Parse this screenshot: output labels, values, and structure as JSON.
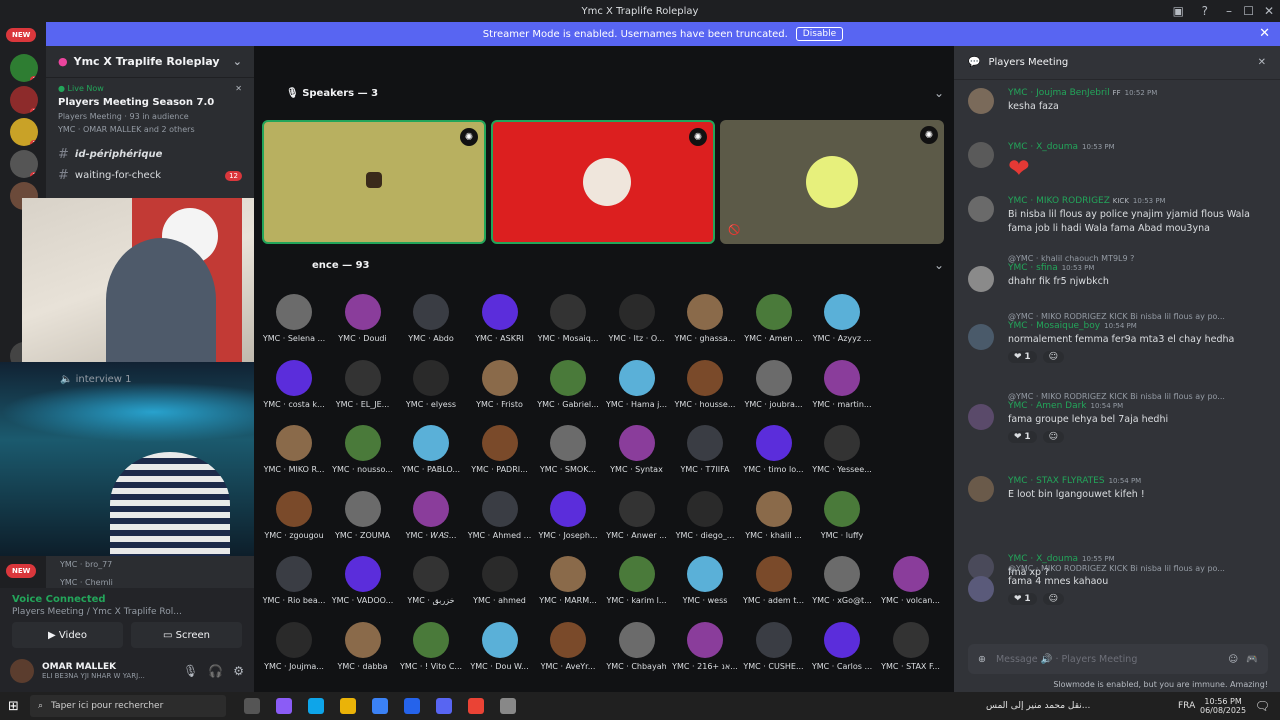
{
  "window": {
    "title": "Ymc X Traplife Roleplay"
  },
  "banner": {
    "text": "Streamer Mode is enabled. Usernames have been truncated.",
    "button": "Disable"
  },
  "servers": {
    "new_top": "NEW",
    "new_bottom": "NEW",
    "badges": [
      "1",
      "1",
      "2",
      "1",
      "1"
    ]
  },
  "guild": {
    "name": "Ymc X Traplife Roleplay"
  },
  "event": {
    "live": "Live Now",
    "title": "Players Meeting Season 7.0",
    "meta1": "Players Meeting · 93 in audience",
    "meta2": "YMC · OMAR MALLEK and 2 others"
  },
  "channels": [
    {
      "name": "id-périphérique",
      "count": ""
    },
    {
      "name": "waiting-for-check",
      "count": "12"
    },
    {
      "name": "interview 1",
      "count": ""
    }
  ],
  "voice": {
    "status": "Voice Connected",
    "sub": "Players Meeting / Ymc X Traplife Rol...",
    "video": "Video",
    "screen": "Screen",
    "members": [
      "YMC · bro_77",
      "YMC · Chemli"
    ]
  },
  "user": {
    "name": "OMAR MALLEK",
    "status": "ELI BE3NA YJI NHAR W YARJ..."
  },
  "stage": {
    "speakers_title": "Speakers — 3",
    "audience_title": "ence — 93"
  },
  "audience": [
    [
      "YMC · Selena ...",
      "YMC · Doudi",
      "YMC · Abdo",
      "YMC · ASKRI",
      "YMC · Mosaiq...",
      "YMC · Itz · O...",
      "YMC · ghassa...",
      "YMC · Amen ...",
      "YMC · Azyyz ..."
    ],
    [
      "YMC · costa k...",
      "YMC · EL_JE...",
      "YMC · elyess",
      "YMC · Fristo",
      "YMC · Gabriel...",
      "YMC · Hama j...",
      "YMC · housse...",
      "YMC · joubra...",
      "YMC · martin..."
    ],
    [
      "YMC · MIKO R...",
      "YMC · nousso...",
      "YMC · PABLO...",
      "YMC · PADRI...",
      "YMC · SMOK...",
      "YMC · Syntax",
      "YMC · T7IIFA",
      "YMC · timo lo...",
      "YMC · Yessee..."
    ],
    [
      "YMC · zgougou",
      "YMC · ZOUMA",
      "YMC · 𝑊𝐴𝑆...",
      "YMC · Ahmed ...",
      "YMC · Joseph...",
      "YMC · Anwer ...",
      "YMC · diego_...",
      "YMC · khalil ...",
      "YMC · luffy"
    ],
    [
      "YMC · Rio bea...",
      "YMC · VADOO...",
      "YMC · خزربق",
      "YMC · ahmed",
      "YMC · MARM...",
      "YMC · karim l...",
      "YMC · wess",
      "YMC · adem t...",
      "YMC · xGo@t...",
      "YMC · volcan..."
    ],
    [
      "YMC · Joujma...",
      "YMC · dabba",
      "YMC · ! Vito C...",
      "YMC · Dou W...",
      "YMC · AveYr...",
      "YMC · Chbayah",
      "YMC · אנ +216...",
      "YMC · CUSHE...",
      "YMC · Carlos ...",
      "YMC · STAX F..."
    ]
  ],
  "chat": {
    "title": "Players Meeting",
    "messages": [
      {
        "author": "YMC · Joujma BenJebril",
        "tag": "FF",
        "time": "10:52 PM",
        "text": "kesha faza"
      },
      {
        "author": "YMC · X_douma",
        "time": "10:53 PM",
        "text": "❤"
      },
      {
        "author": "YMC · MIKO RODRIGEZ",
        "tag": "KICK",
        "time": "10:53 PM",
        "text": "Bi nisba lil flous ay police ynajim yjamid flous Wala fama job li hadi Wala fama Abad mou3yna"
      },
      {
        "reply": "@YMC · khalil chaouch MT9L9 ?",
        "author": "YMC · sfina",
        "time": "10:53 PM",
        "text": "dhahr fik fr5 njwbkch"
      },
      {
        "reply": "@YMC · MIKO RODRIGEZ KICK Bi nisba lil flous ay po...",
        "author": "YMC · Mosaique_boy",
        "time": "10:54 PM",
        "text": "normalement femma fer9a mta3 el chay hedha",
        "react": "1"
      },
      {
        "reply": "@YMC · MIKO RODRIGEZ KICK Bi nisba lil flous ay po...",
        "author": "YMC · Amen Dark",
        "time": "10:54 PM",
        "text": "fama groupe lehya bel 7aja hedhi",
        "react": "1"
      },
      {
        "author": "YMC · STAX FLYRATES",
        "time": "10:54 PM",
        "text": "E loot bin lgangouwet kifeh !"
      },
      {
        "author": "YMC · X_douma",
        "time": "10:55 PM",
        "text": "fma xp ?"
      },
      {
        "reply": "@YMC · MIKO RODRIGEZ KICK Bi nisba lil flous ay po...",
        "author": "",
        "time": "",
        "text": "fama 4 mnes kahaou",
        "react": "1"
      }
    ],
    "composer_placeholder": "Message 🔊 · Players Meeting",
    "slowmode": "Slowmode is enabled, but you are immune. Amazing!"
  },
  "taskbar": {
    "search": "Taper ici pour rechercher",
    "news": "نقل محمد منير إلى المس...",
    "lang": "FRA",
    "time": "10:56 PM",
    "date": "06/08/2025"
  }
}
